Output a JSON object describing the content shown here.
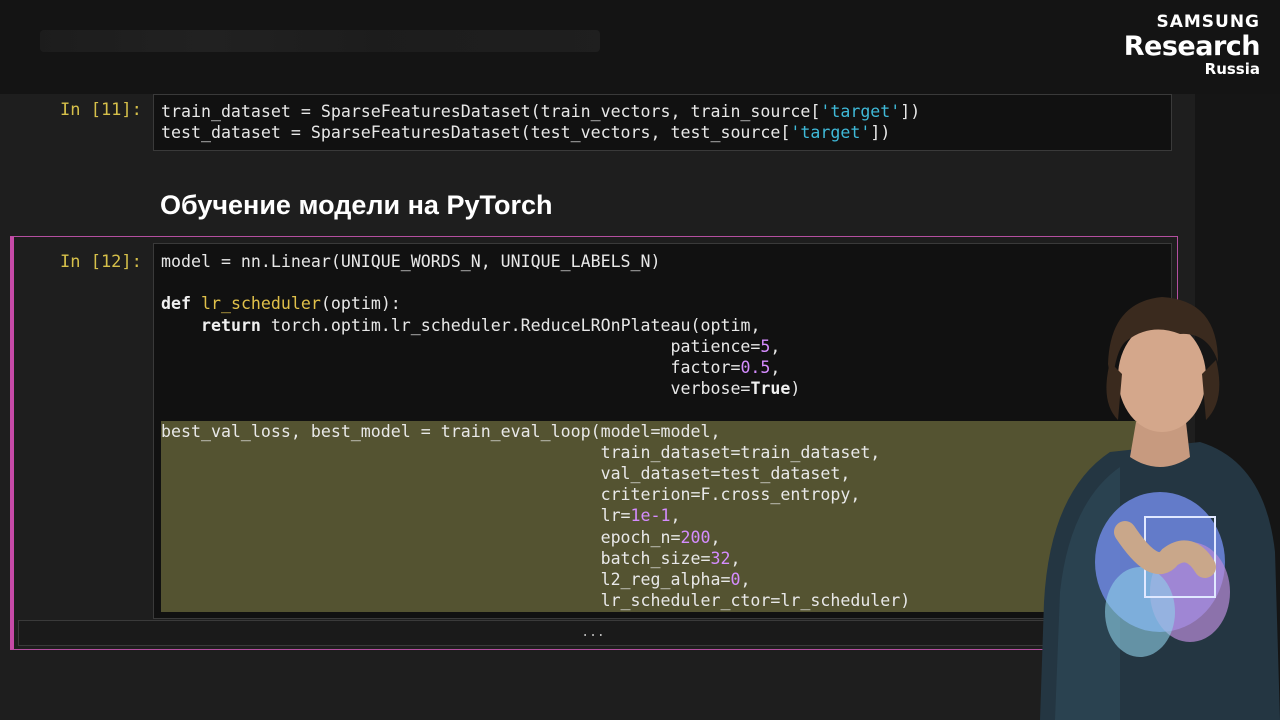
{
  "branding": {
    "line1": "SAMSUNG",
    "line2": "Research",
    "line3": "Russia"
  },
  "cells": [
    {
      "prompt": "In [11]:",
      "lines": [
        [
          {
            "t": "train_dataset = SparseFeaturesDataset(train_vectors, train_source["
          },
          {
            "t": "'target'",
            "c": "str"
          },
          {
            "t": "])"
          }
        ],
        [
          {
            "t": "test_dataset = SparseFeaturesDataset(test_vectors, test_source["
          },
          {
            "t": "'target'",
            "c": "str"
          },
          {
            "t": "])"
          }
        ]
      ]
    },
    {
      "prompt": "In [12]:",
      "lines": [
        [
          {
            "t": "model = nn.Linear(UNIQUE_WORDS_N, UNIQUE_LABELS_N)"
          }
        ],
        [
          {
            "t": ""
          }
        ],
        [
          {
            "t": "def",
            "c": "kw"
          },
          {
            "t": " "
          },
          {
            "t": "lr_scheduler",
            "c": "fn"
          },
          {
            "t": "(optim):"
          }
        ],
        [
          {
            "t": "    "
          },
          {
            "t": "return",
            "c": "kw"
          },
          {
            "t": " torch.optim.lr_scheduler.ReduceLROnPlateau(optim,"
          }
        ],
        [
          {
            "t": "                                                   patience="
          },
          {
            "t": "5",
            "c": "num"
          },
          {
            "t": ","
          }
        ],
        [
          {
            "t": "                                                   factor="
          },
          {
            "t": "0.5",
            "c": "num"
          },
          {
            "t": ","
          }
        ],
        [
          {
            "t": "                                                   verbose="
          },
          {
            "t": "True",
            "c": "kw"
          },
          {
            "t": ")"
          }
        ],
        [
          {
            "t": ""
          }
        ],
        [
          {
            "t": "best_val_loss, best_model = train_eval_loop(model=model,"
          }
        ],
        [
          {
            "t": "                                            train_dataset=train_dataset,"
          }
        ],
        [
          {
            "t": "                                            val_dataset=test_dataset,"
          }
        ],
        [
          {
            "t": "                                            criterion=F.cross_entropy,"
          }
        ],
        [
          {
            "t": "                                            lr="
          },
          {
            "t": "1e-1",
            "c": "num"
          },
          {
            "t": ","
          }
        ],
        [
          {
            "t": "                                            epoch_n="
          },
          {
            "t": "200",
            "c": "num"
          },
          {
            "t": ","
          }
        ],
        [
          {
            "t": "                                            batch_size="
          },
          {
            "t": "32",
            "c": "num"
          },
          {
            "t": ","
          }
        ],
        [
          {
            "t": "                                            l2_reg_alpha="
          },
          {
            "t": "0",
            "c": "num"
          },
          {
            "t": ","
          }
        ],
        [
          {
            "t": "                                            lr_scheduler_ctor=lr_scheduler)"
          }
        ]
      ]
    }
  ],
  "markdown_heading": "Обучение модели на PyTorch",
  "collapsed_output": "...",
  "colors": {
    "selected_cell_border": "#c64aa7",
    "prompt": "#d6c04a",
    "string": "#3fb9d8",
    "number": "#d58cff",
    "selection_highlight": "#545331"
  }
}
